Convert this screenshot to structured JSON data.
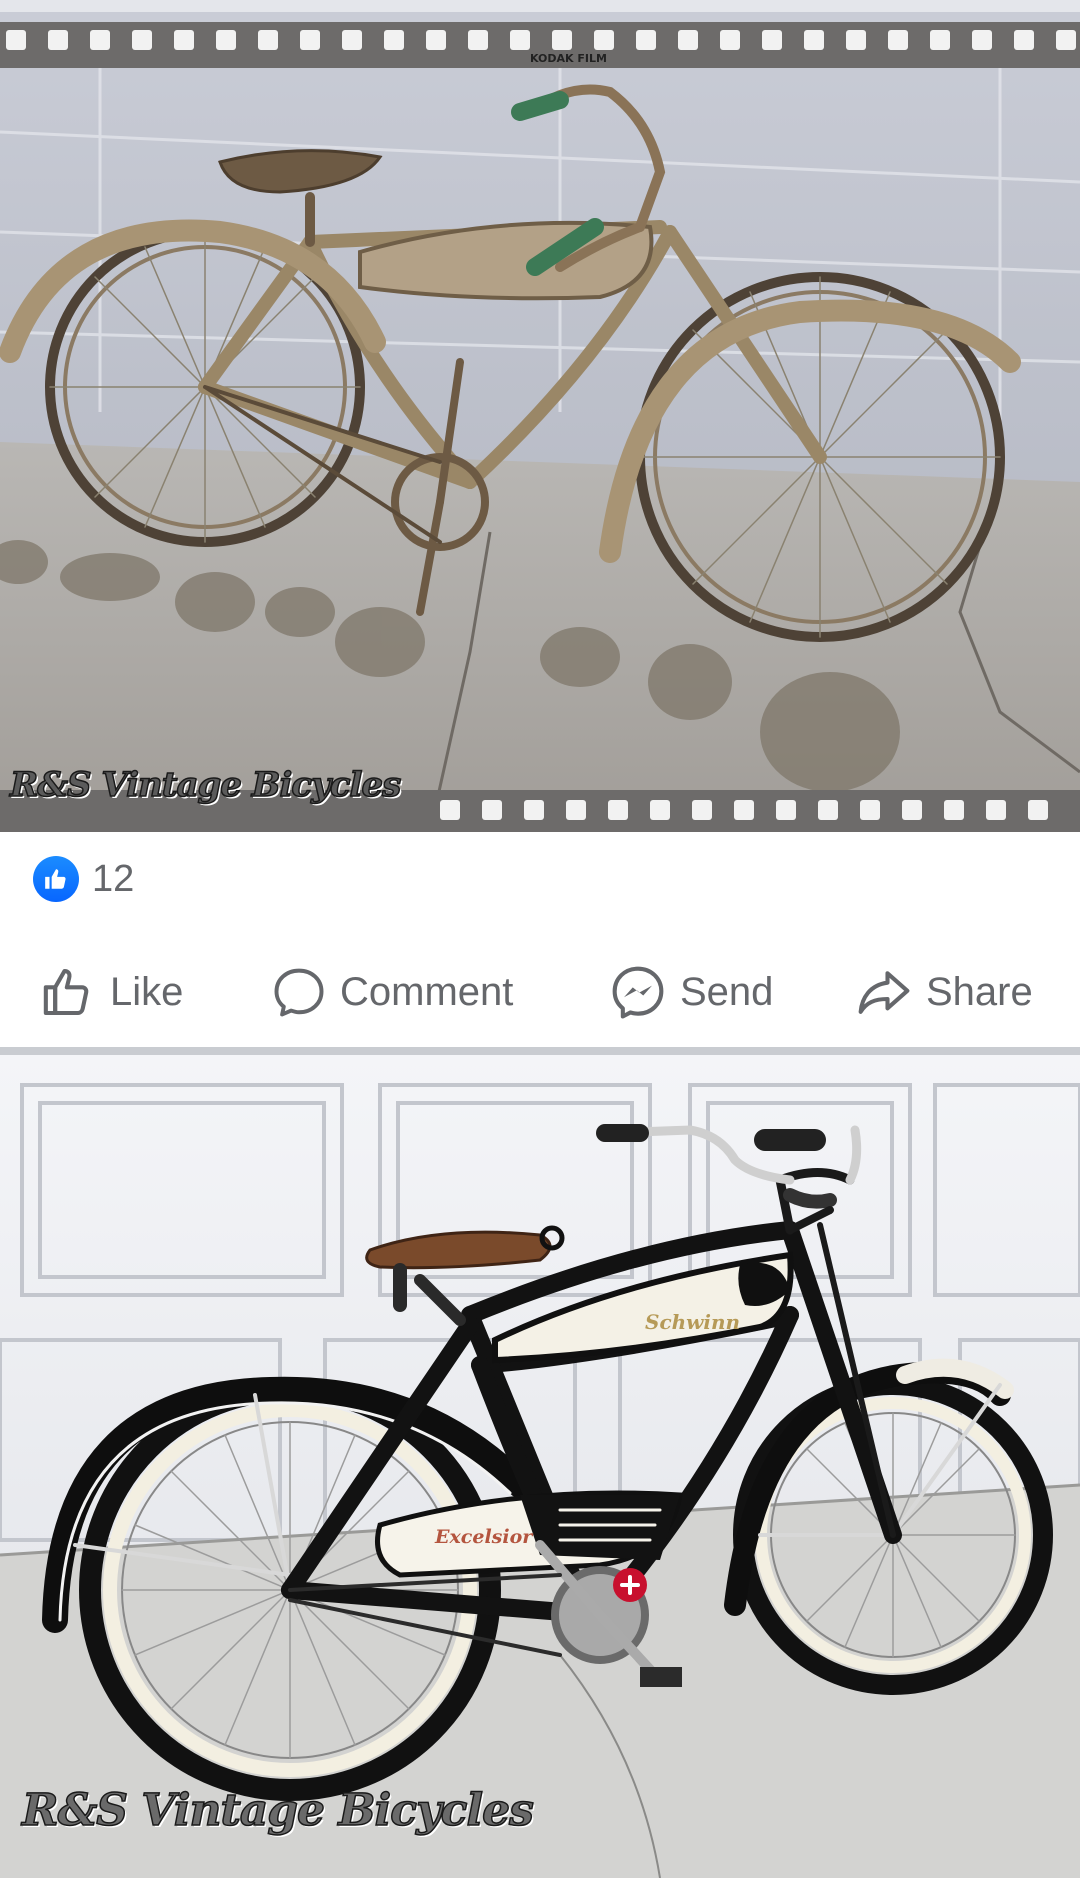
{
  "post": {
    "photo_1_watermark": "R&S Vintage Bicycles",
    "photo_2_watermark": "R&S Vintage Bicycles",
    "reactions": {
      "icon": "thumbs-up-icon",
      "count": "12",
      "color": "#0866ff"
    },
    "actions": [
      {
        "label": "Like",
        "icon": "thumbs-up-outline-icon"
      },
      {
        "label": "Comment",
        "icon": "speech-bubble-icon"
      },
      {
        "label": "Send",
        "icon": "messenger-icon"
      },
      {
        "label": "Share",
        "icon": "share-arrow-icon"
      }
    ]
  },
  "photo_1_text": {
    "film_edge": "KODAK FILM"
  },
  "photo_2_text": {
    "tank_logo": "Schwinn",
    "chain_guard_logo": "Excelsior"
  }
}
